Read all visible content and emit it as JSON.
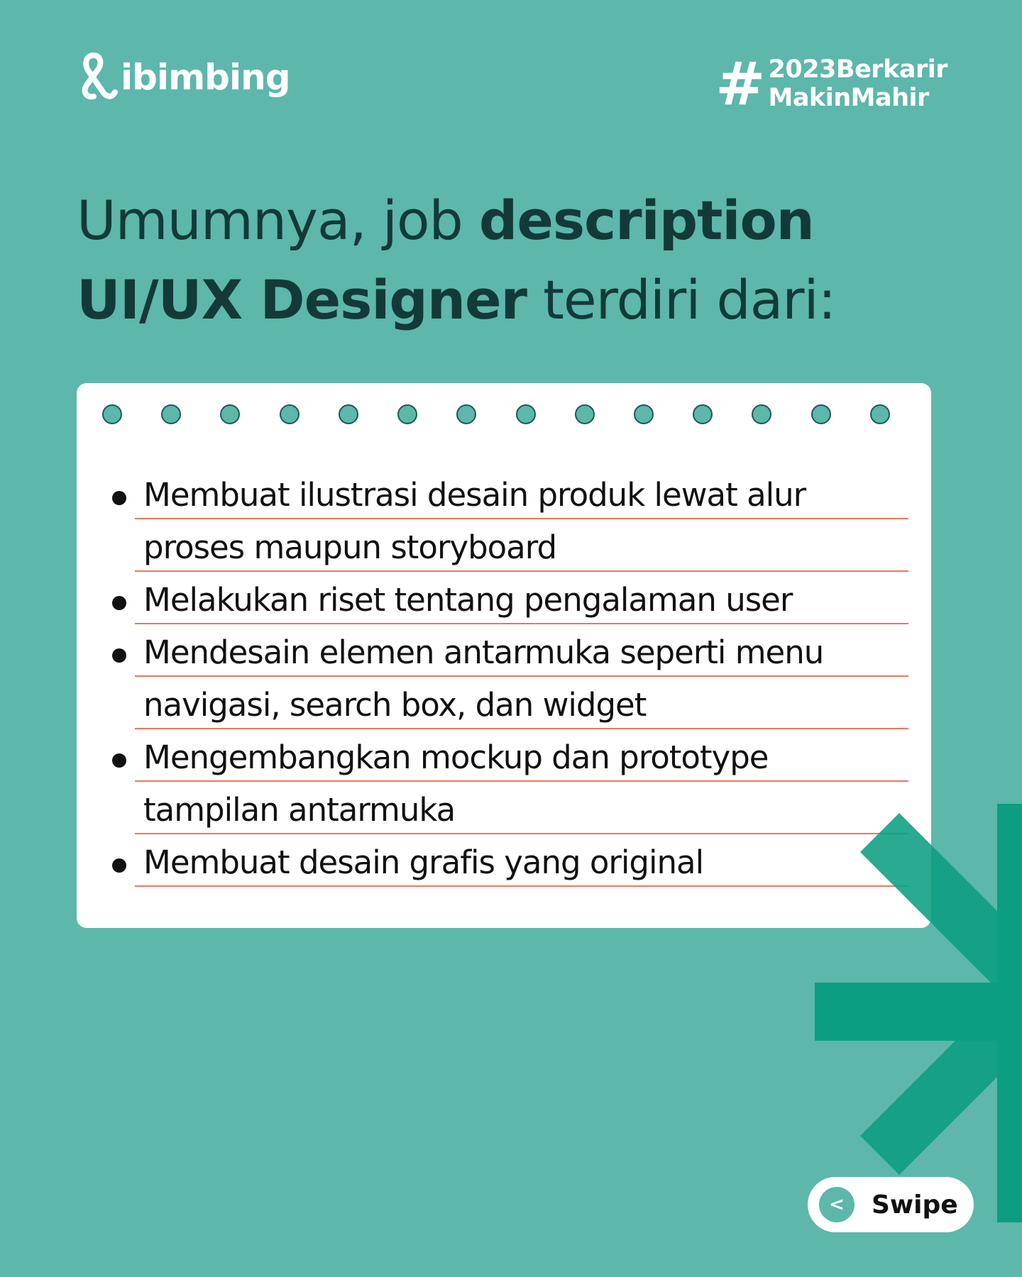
{
  "brand": {
    "logo_text": "ibimbing",
    "hashtag_symbol": "#",
    "hashtag_lines": [
      "2023Berkarir",
      "MakinMahir"
    ]
  },
  "headline": {
    "part1": "Umumnya, job ",
    "part2_bold": "description",
    "part3_bold": "UI/UX Designer",
    "part4": " terdiri dari:"
  },
  "items": [
    {
      "lines": [
        "Membuat ilustrasi desain produk lewat alur",
        "proses maupun storyboard"
      ]
    },
    {
      "lines": [
        "Melakukan riset tentang pengalaman user"
      ]
    },
    {
      "lines": [
        "Mendesain elemen antarmuka seperti menu",
        "navigasi, search box, dan widget"
      ]
    },
    {
      "lines": [
        "Mengembangkan mockup dan prototype",
        "tampilan antarmuka"
      ]
    },
    {
      "lines": [
        "Membuat desain grafis yang original"
      ]
    }
  ],
  "swipe": {
    "arrow": "<",
    "label": "Swipe"
  },
  "colors": {
    "background": "#5db7aa",
    "heading": "#133a38",
    "rule": "#e8795c",
    "accent": "#0b9e82"
  }
}
